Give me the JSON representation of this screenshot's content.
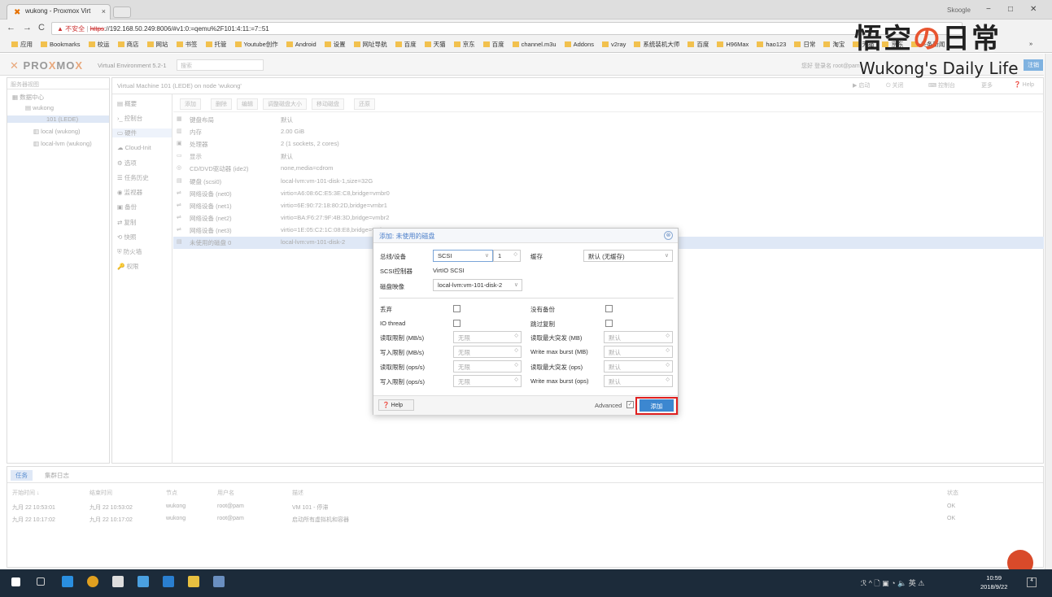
{
  "browser": {
    "tab_title": "wukong - Proxmox Virt",
    "tab_close": "×",
    "profile": "Skoogle",
    "min": "−",
    "max": "□",
    "close": "✕",
    "back": "←",
    "forward": "→",
    "reload": "C",
    "insecure": "▲ 不安全",
    "url_https": "https",
    "url_rest": "://192.168.50.249:8006/#v1:0:=qemu%2F101:4:11:=7::51",
    "bookmarks": [
      "应用",
      "Bookmarks",
      "校运",
      "商店",
      "网站",
      "书签",
      "托管",
      "Youtube创作",
      "Android",
      "设置",
      "网址导航",
      "百度",
      "天猫",
      "京东",
      "百度",
      "channel.m3u",
      "Addons",
      "v2ray",
      "系统装机大师",
      "百度",
      "H96Max",
      "hao123",
      "日常",
      "淘宝",
      "天猫",
      "京东",
      "头条新闻"
    ],
    "more_bm": "»"
  },
  "pve": {
    "logo_a": "PRO",
    "logo_x": "X",
    "logo_b": "MO",
    "logo_c": "X",
    "version": "Virtual Environment 5.2-1",
    "search_placeholder": "搜索",
    "header_right": "您好 登录名 root@pam",
    "header_btn": "注销"
  },
  "tree": {
    "header": "服务器视图",
    "items": [
      "数据中心",
      "wukong",
      "101 (LEDE)",
      "local (wukong)",
      "local-lvm (wukong)"
    ]
  },
  "content": {
    "title": "Virtual Machine 101 (LEDE) on node 'wukong'",
    "top_buttons": [
      "▶ 启动",
      "⏻ 关闭",
      "⌨ 控制台",
      "更多",
      "❓ Help"
    ],
    "nav": [
      "概要",
      "控制台",
      "硬件",
      "Cloud-Init",
      "选项",
      "任务历史",
      "监视器",
      "备份",
      "复制",
      "快照",
      "防火墙",
      "权限"
    ],
    "toolbar": [
      "添加",
      "删除",
      "编辑",
      "调整磁盘大小",
      "移动磁盘",
      "还原"
    ],
    "hw": [
      {
        "k": "键盘布局",
        "v": "默认"
      },
      {
        "k": "内存",
        "v": "2.00 GiB"
      },
      {
        "k": "处理器",
        "v": "2 (1 sockets, 2 cores)"
      },
      {
        "k": "显示",
        "v": "默认"
      },
      {
        "k": "CD/DVD驱动器 (ide2)",
        "v": "none,media=cdrom"
      },
      {
        "k": "硬盘 (scsi0)",
        "v": "local-lvm:vm-101-disk-1,size=32G"
      },
      {
        "k": "网络设备 (net0)",
        "v": "virtio=A6:08:6C:E5:3E:C8,bridge=vmbr0"
      },
      {
        "k": "网络设备 (net1)",
        "v": "virtio=6E:90:72:18:80:2D,bridge=vmbr1"
      },
      {
        "k": "网络设备 (net2)",
        "v": "virtio=BA:F6:27:9F:4B:3D,bridge=vmbr2"
      },
      {
        "k": "网络设备 (net3)",
        "v": "virtio=1E:05:C2:1C:08:E8,bridge=vmbr3"
      },
      {
        "k": "未使用的磁盘 0",
        "v": "local-lvm:vm-101-disk-2"
      }
    ]
  },
  "log": {
    "tabs": [
      "任务",
      "集群日志"
    ],
    "headers": [
      "开始时间 ↓",
      "结束时间",
      "节点",
      "用户名",
      "描述",
      "状态"
    ],
    "rows": [
      [
        "九月 22 10:53:01",
        "九月 22 10:53:02",
        "wukong",
        "root@pam",
        "VM 101 - 停滞",
        "OK"
      ],
      [
        "九月 22 10:17:02",
        "九月 22 10:17:02",
        "wukong",
        "root@pam",
        "启动所有虚拟机和容器",
        "OK"
      ]
    ]
  },
  "dialog": {
    "title": "添加: 未使用的磁盘",
    "close": "⊗",
    "bus_label": "总线/设备",
    "bus_value": "SCSI",
    "bus_index": "1",
    "cache_label": "缓存",
    "cache_value": "默认 (无缓存)",
    "ctrl_label": "SCSI控制器",
    "ctrl_value": "VirtIO SCSI",
    "image_label": "磁盘映像",
    "image_value": "local-lvm:vm-101-disk-2",
    "discard_label": "丢弃",
    "nobackup_label": "没有备份",
    "iothread_label": "IO thread",
    "skiprep_label": "跳过复制",
    "rl": [
      {
        "label": "读取限制 (MB/s)",
        "value": "无限"
      },
      {
        "label": "写入限制 (MB/s)",
        "value": "无限"
      },
      {
        "label": "读取限制 (ops/s)",
        "value": "无限"
      },
      {
        "label": "写入限制 (ops/s)",
        "value": "无限"
      }
    ],
    "rr": [
      {
        "label": "读取最大突发 (MB)",
        "value": "默认"
      },
      {
        "label": "Write max burst (MB)",
        "value": "默认"
      },
      {
        "label": "读取最大突发 (ops)",
        "value": "默认"
      },
      {
        "label": "Write max burst (ops)",
        "value": "默认"
      }
    ],
    "help": "❓ Help",
    "advanced": "Advanced",
    "add": "添加"
  },
  "watermark": {
    "line1_a": "悟空",
    "line1_b": "の",
    "line1_c": "日常",
    "line2": "Wukong's Daily Life"
  },
  "taskbar": {
    "clock_time": "10:59",
    "clock_date": "2018/9/22",
    "tray": "ℛ ^ 🗋 ▣ ◔ 🔈 英 ⚠",
    "notif": "4"
  }
}
